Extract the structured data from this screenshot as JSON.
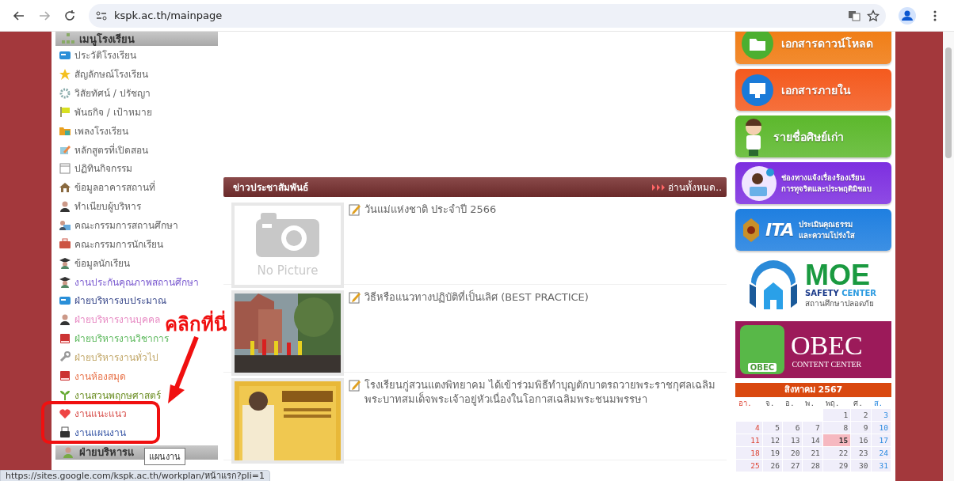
{
  "browser": {
    "url": "kspk.ac.th/mainpage",
    "status_url": "https://sites.google.com/kspk.ac.th/workplan/หน้าแรก?pli=1"
  },
  "sidebar": {
    "heading": "เมนูโรงเรียน",
    "items": [
      {
        "label": "ประวัติโรงเรียน",
        "color": "#666666"
      },
      {
        "label": "สัญลักษณ์โรงเรียน",
        "color": "#666666"
      },
      {
        "label": "วิสัยทัศน์ / ปรัชญา",
        "color": "#666666"
      },
      {
        "label": "พันธกิจ / เป้าหมาย",
        "color": "#666666"
      },
      {
        "label": "เพลงโรงเรียน",
        "color": "#666666"
      },
      {
        "label": "หลักสูตรที่เปิดสอน",
        "color": "#666666"
      },
      {
        "label": "ปฏิทินกิจกรรม",
        "color": "#666666"
      },
      {
        "label": "ข้อมูลอาคารสถานที่",
        "color": "#666666"
      },
      {
        "label": "ทำเนียบผู้บริหาร",
        "color": "#666666"
      },
      {
        "label": "คณะกรรมการสถานศึกษา",
        "color": "#666666"
      },
      {
        "label": "คณะกรรมการนักเรียน",
        "color": "#666666"
      },
      {
        "label": "ข้อมูลนักเรียน",
        "color": "#666666"
      },
      {
        "label": "งานประกันคุณภาพสถานศึกษา",
        "color": "#7b5bd0"
      },
      {
        "label": "ฝ่ายบริหารงบประมาณ",
        "color": "#3b4a8c"
      },
      {
        "label": "ฝ่ายบริหารงานบุคคล",
        "color": "#e78ac3"
      },
      {
        "label": "ฝ่ายบริหารงานวิชาการ",
        "color": "#5cb85c"
      },
      {
        "label": "ฝ่ายบริหารงานทั่วไป",
        "color": "#c2a86a"
      },
      {
        "label": "งานห้องสมุด",
        "color": "#e8734a"
      },
      {
        "label": "งานสวนพฤกษศาสตร์",
        "color": "#6b8e23"
      },
      {
        "label": "งานแนะแนว",
        "color": "#d9534f"
      },
      {
        "label": "งานแผนงาน",
        "color": "#3c5aa8"
      }
    ],
    "next_heading": "ฝ่ายบริหารแ",
    "tooltip": "แผนงาน"
  },
  "annotation": {
    "text": "คลิกที่นี่"
  },
  "news": {
    "title": "ข่าวประชาสัมพันธ์",
    "read_all": "อ่านทั้งหมด..",
    "items": [
      {
        "title": "วันแม่แห่งชาติ ประจำปี 2566",
        "thumbnail": {
          "kind": "placeholder",
          "text": "No Picture"
        }
      },
      {
        "title": "วิธีหรือแนวทางปฏิบัติที่เป็นเลิศ (BEST PRACTICE)"
      },
      {
        "title": "โรงเรียนกู่สวนแตงพิทยาคม ได้เข้าร่วมพิธีทำบุญตักบาตรถวายพระราชกุศลเฉลิมพระบาทสมเด็จพระเจ้าอยู่หัวเนื่องในโอกาสเฉลิมพระชนมพรรษา",
        "thumbnail": {
          "kind": "poster"
        }
      }
    ]
  },
  "banners": [
    {
      "kind": "download",
      "lines": [
        "เอกสารดาวน์โหลด"
      ],
      "color": "#f07a10"
    },
    {
      "kind": "internal",
      "lines": [
        "เอกสารภายใน"
      ],
      "color": "#f45a1e"
    },
    {
      "kind": "alumni",
      "lines": [
        "รายชื่อศิษย์เก่า"
      ],
      "color": "#5cb82c"
    },
    {
      "kind": "complaint",
      "lines": [
        "ช่องทางแจ้งเรื่องร้องเรียน",
        "การทุจริตและประพฤติมิชอบ"
      ],
      "color": "#7d2fe0"
    },
    {
      "kind": "ita",
      "logo": "ITA",
      "lines": [
        "ประเมินคุณธรรม",
        "และความโปร่งใส"
      ],
      "color": "#1f7fe0"
    },
    {
      "kind": "moe",
      "title": "MOE",
      "lines": [
        "SAFETY",
        "CENTER"
      ],
      "subtitle": "สถานศึกษาปลอดภัย"
    },
    {
      "kind": "obec",
      "badge": "OBEC",
      "title": "OBEC",
      "subtitle": "CONTENT CENTER",
      "color": "#9c1a5a"
    }
  ],
  "calendar": {
    "title": "สิงหาคม 2567",
    "weekdays": [
      "อา.",
      "จ.",
      "อ.",
      "พ.",
      "พฤ.",
      "ศ.",
      "ส."
    ],
    "weeks": [
      [
        {
          "day": "1",
          "selected": false
        },
        {
          "day": "2",
          "selected": false
        },
        {
          "day": "3",
          "selected": false
        }
      ],
      [
        {
          "day": "4",
          "selected": false
        },
        {
          "day": "5",
          "selected": false
        },
        {
          "day": "6",
          "selected": false
        },
        {
          "day": "7",
          "selected": false
        },
        {
          "day": "8",
          "selected": false
        },
        {
          "day": "9",
          "selected": false
        },
        {
          "day": "10",
          "selected": false
        }
      ],
      [
        {
          "day": "11",
          "selected": false
        },
        {
          "day": "12",
          "selected": false
        },
        {
          "day": "13",
          "selected": false
        },
        {
          "day": "14",
          "selected": false
        },
        {
          "day": "15",
          "selected": true
        },
        {
          "day": "16",
          "selected": false
        },
        {
          "day": "17",
          "selected": false
        }
      ],
      [
        {
          "day": "18",
          "selected": false
        },
        {
          "day": "19",
          "selected": false
        },
        {
          "day": "20",
          "selected": false
        },
        {
          "day": "21",
          "selected": false
        },
        {
          "day": "22",
          "selected": false
        },
        {
          "day": "23",
          "selected": false
        },
        {
          "day": "24",
          "selected": false
        }
      ],
      [
        {
          "day": "25",
          "selected": false
        },
        {
          "day": "26",
          "selected": false
        },
        {
          "day": "27",
          "selected": false
        },
        {
          "day": "28",
          "selected": false
        },
        {
          "day": "29",
          "selected": false
        },
        {
          "day": "30",
          "selected": false
        },
        {
          "day": "31",
          "selected": false
        }
      ]
    ]
  }
}
